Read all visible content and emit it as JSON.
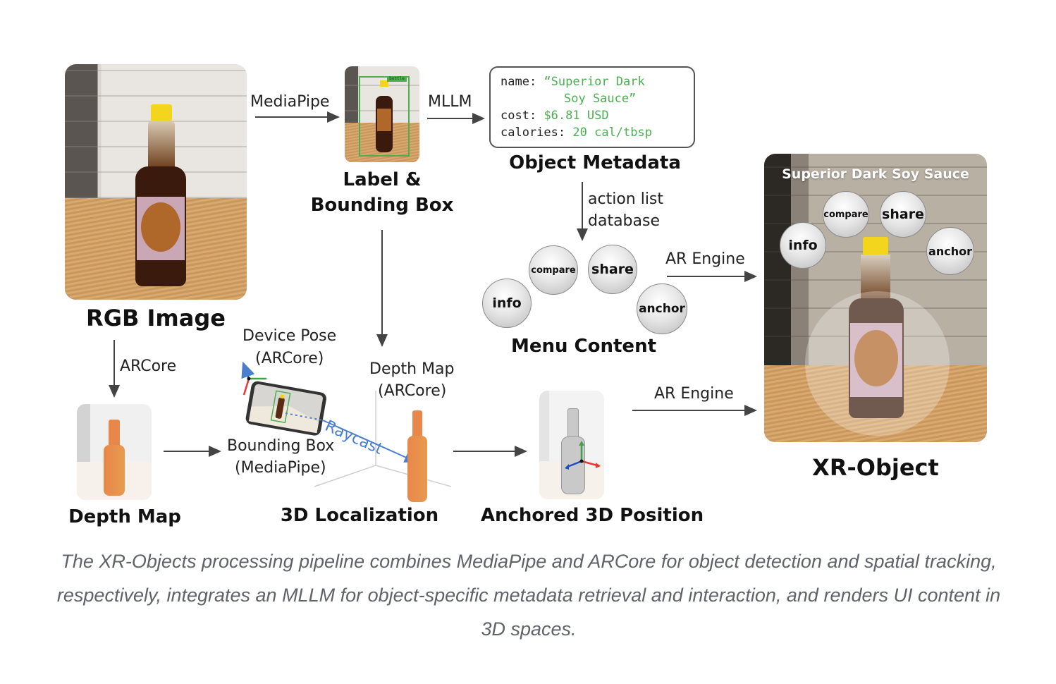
{
  "stages": {
    "rgb_image": {
      "title": "RGB Image"
    },
    "label_bbox": {
      "title_line1": "Label &",
      "title_line2": "Bounding Box",
      "detection_tag": "bottle"
    },
    "object_metadata": {
      "title": "Object Metadata",
      "fields": [
        {
          "key": "name:",
          "value": "“Superior Dark",
          "value_cont": "Soy Sauce”"
        },
        {
          "key": "cost:",
          "value": "$6.81 USD"
        },
        {
          "key": "calories:",
          "value": "20 cal/tbsp"
        }
      ]
    },
    "menu_content": {
      "title": "Menu Content",
      "buttons": [
        "info",
        "compare",
        "share",
        "anchor"
      ]
    },
    "xr_object": {
      "title": "XR-Object",
      "overlay_title": "Superior Dark Soy Sauce",
      "buttons": [
        "info",
        "compare",
        "share",
        "anchor"
      ]
    },
    "depth_map": {
      "title": "Depth Map"
    },
    "localization": {
      "title": "3D Localization",
      "device_pose_line1": "Device Pose",
      "device_pose_line2": "(ARCore)",
      "depth_map_line1": "Depth Map",
      "depth_map_line2": "(ARCore)",
      "bbox_line1": "Bounding Box",
      "bbox_line2": "(MediaPipe)",
      "raycast": "Raycast"
    },
    "anchored": {
      "title": "Anchored 3D Position"
    }
  },
  "edges": {
    "mediapipe": "MediaPipe",
    "mllm": "MLLM",
    "action_list_line1": "action list",
    "action_list_line2": "database",
    "ar_engine_top": "AR Engine",
    "ar_engine_bottom": "AR Engine",
    "arcore": "ARCore"
  },
  "colors": {
    "metadata_value": "#4caf50",
    "raycast": "#4a7fd0",
    "depth_orange": "#e8874a",
    "axis_red": "#e53935",
    "axis_green": "#43a047",
    "axis_blue": "#1e4fc2",
    "caption": "#5f6368"
  },
  "caption": "The XR-Objects processing pipeline combines MediaPipe and ARCore for object detection and spatial tracking, respectively, integrates an MLLM for object-specific metadata retrieval and interaction, and renders UI content in 3D spaces."
}
